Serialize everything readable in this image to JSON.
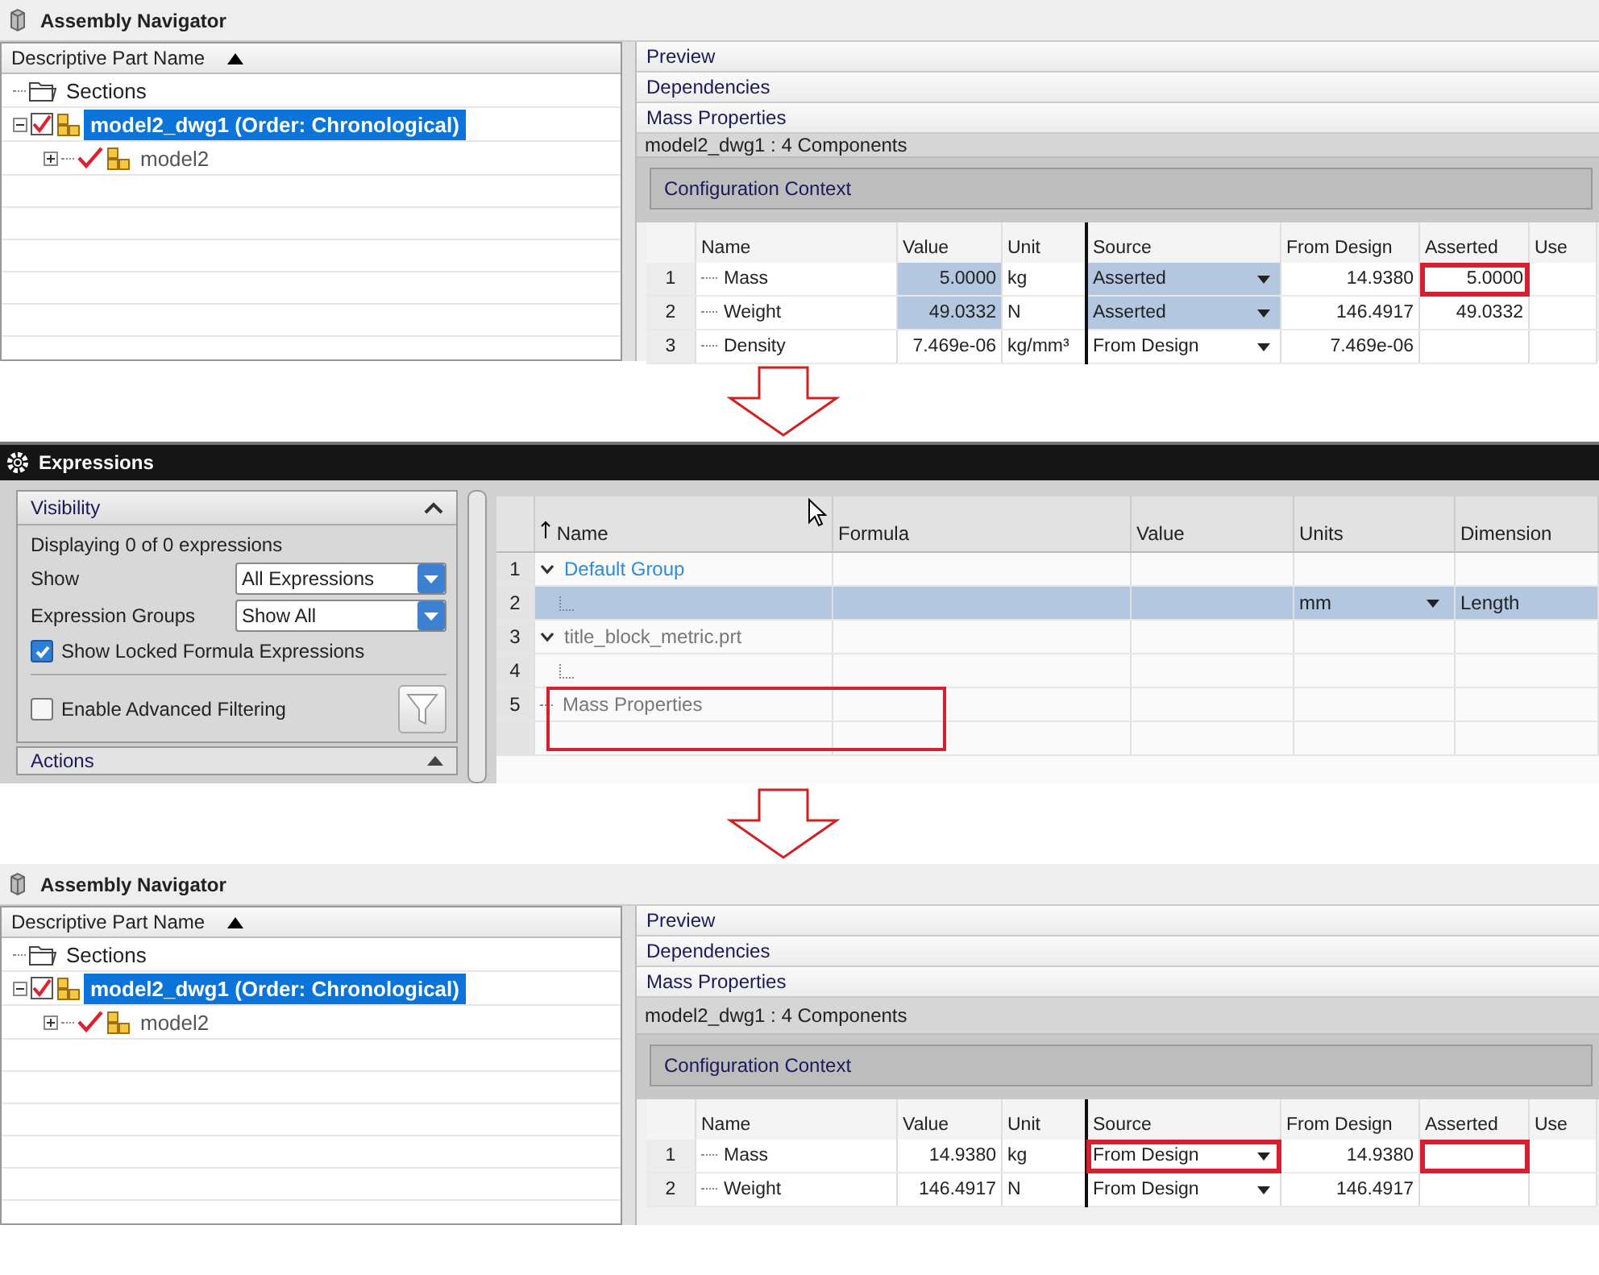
{
  "panels": [
    {
      "kind": "navigator",
      "title": "Assembly Navigator",
      "tree": {
        "header": "Descriptive Part Name",
        "items": [
          {
            "label": "Sections",
            "kind": "folder"
          },
          {
            "label": "model2_dwg1 (Order: Chronological)",
            "kind": "assembly",
            "checked": true,
            "selected": true,
            "expanded": true,
            "children": [
              {
                "label": "model2",
                "kind": "assembly",
                "checked": true,
                "selected": false,
                "expanded": false
              }
            ]
          }
        ]
      },
      "sections": [
        {
          "label": "Preview"
        },
        {
          "label": "Dependencies"
        },
        {
          "label": "Mass Properties"
        }
      ],
      "summary": "model2_dwg1 : 4 Components",
      "context": "Configuration Context",
      "table": {
        "columns": [
          {
            "kind": "rownum"
          },
          {
            "label": "Name",
            "kind": "text"
          },
          {
            "label": "Value",
            "kind": "input"
          },
          {
            "label": "Unit",
            "kind": "text"
          },
          {
            "label": "Source",
            "kind": "dropdown"
          },
          {
            "label": "From Design",
            "kind": "number"
          },
          {
            "label": "Asserted",
            "kind": "number"
          },
          {
            "label": "Use"
          }
        ],
        "rows": [
          {
            "selected": true,
            "cells": [
              {
                "text": "1",
                "highlighted": false
              },
              {
                "text": "Mass",
                "highlighted": false
              },
              {
                "text": "5.0000",
                "highlighted": false
              },
              {
                "text": "kg",
                "highlighted": false
              },
              {
                "text": "Asserted",
                "highlighted": false
              },
              {
                "text": "14.9380",
                "highlighted": false
              },
              {
                "text": "5.0000",
                "highlighted": true
              }
            ]
          },
          {
            "selected": true,
            "cells": [
              {
                "text": "2",
                "highlighted": false
              },
              {
                "text": "Weight",
                "highlighted": false
              },
              {
                "text": "49.0332",
                "highlighted": false
              },
              {
                "text": "N",
                "highlighted": false
              },
              {
                "text": "Asserted",
                "highlighted": false
              },
              {
                "text": "146.4917",
                "highlighted": false
              },
              {
                "text": "49.0332",
                "highlighted": false
              }
            ]
          },
          {
            "selected": false,
            "cells": [
              {
                "text": "3",
                "highlighted": false
              },
              {
                "text": "Density",
                "highlighted": false
              },
              {
                "text": "7.469e-06",
                "highlighted": false
              },
              {
                "text": "kg/mm³",
                "highlighted": false
              },
              {
                "text": "From Design",
                "highlighted": false
              },
              {
                "text": "7.469e-06",
                "highlighted": false
              },
              {
                "highlighted": false
              }
            ]
          }
        ]
      }
    },
    {
      "kind": "expressions",
      "title": "Expressions",
      "visibility": {
        "title": "Visibility",
        "displaying": "Displaying 0 of 0 expressions",
        "show": {
          "label": "Show",
          "value": "All Expressions"
        },
        "groups": {
          "label": "Expression Groups",
          "value": "Show All"
        },
        "locked": {
          "label": "Show Locked Formula Expressions",
          "checked": true
        },
        "advanced": {
          "label": "Enable Advanced Filtering",
          "checked": false
        }
      },
      "actions_title": "Actions",
      "table": {
        "columns": [
          "Name",
          "Formula",
          "Value",
          "Units",
          "Dimension"
        ],
        "rows": [
          {
            "number": "1",
            "kind": "group",
            "name": "Default Group",
            "active": true,
            "expanded": true,
            "selected": false
          },
          {
            "number": "2",
            "kind": "expression",
            "selected": true,
            "units": "mm",
            "dimension": "Length"
          },
          {
            "number": "3",
            "kind": "group",
            "name": "title_block_metric.prt",
            "active": false,
            "expanded": true,
            "selected": false
          },
          {
            "number": "4",
            "kind": "expression",
            "selected": false
          },
          {
            "number": "5",
            "kind": "category",
            "name": "Mass Properties",
            "selected": false,
            "highlighted": true
          }
        ]
      }
    },
    {
      "kind": "navigator",
      "title": "Assembly Navigator",
      "tree": {
        "header": "Descriptive Part Name",
        "items": [
          {
            "label": "Sections",
            "kind": "folder"
          },
          {
            "label": "model2_dwg1 (Order: Chronological)",
            "kind": "assembly",
            "checked": true,
            "selected": true,
            "expanded": true,
            "children": [
              {
                "label": "model2",
                "kind": "assembly",
                "checked": true,
                "selected": false,
                "expanded": false
              }
            ]
          }
        ]
      },
      "sections": [
        {
          "label": "Preview"
        },
        {
          "label": "Dependencies"
        },
        {
          "label": "Mass Properties"
        }
      ],
      "summary": "model2_dwg1 : 4 Components",
      "context": "Configuration Context",
      "table": {
        "columns": [
          {
            "kind": "rownum"
          },
          {
            "label": "Name",
            "kind": "text"
          },
          {
            "label": "Value",
            "kind": "input"
          },
          {
            "label": "Unit",
            "kind": "text"
          },
          {
            "label": "Source",
            "kind": "dropdown"
          },
          {
            "label": "From Design",
            "kind": "number"
          },
          {
            "label": "Asserted",
            "kind": "number"
          },
          {
            "label": "Use"
          }
        ],
        "rows": [
          {
            "selected": false,
            "cells": [
              {
                "text": "1",
                "highlighted": false
              },
              {
                "text": "Mass",
                "highlighted": false
              },
              {
                "text": "14.9380",
                "highlighted": false
              },
              {
                "text": "kg",
                "highlighted": false
              },
              {
                "text": "From Design",
                "highlighted": true
              },
              {
                "text": "14.9380",
                "highlighted": false
              },
              {
                "highlighted": true
              }
            ]
          },
          {
            "selected": false,
            "cells": [
              {
                "text": "2",
                "highlighted": false
              },
              {
                "text": "Weight",
                "highlighted": false
              },
              {
                "text": "146.4917",
                "highlighted": false
              },
              {
                "text": "N",
                "highlighted": false
              },
              {
                "text": "From Design",
                "highlighted": false
              },
              {
                "text": "146.4917",
                "highlighted": false
              },
              {
                "highlighted": false
              }
            ]
          }
        ]
      }
    }
  ]
}
